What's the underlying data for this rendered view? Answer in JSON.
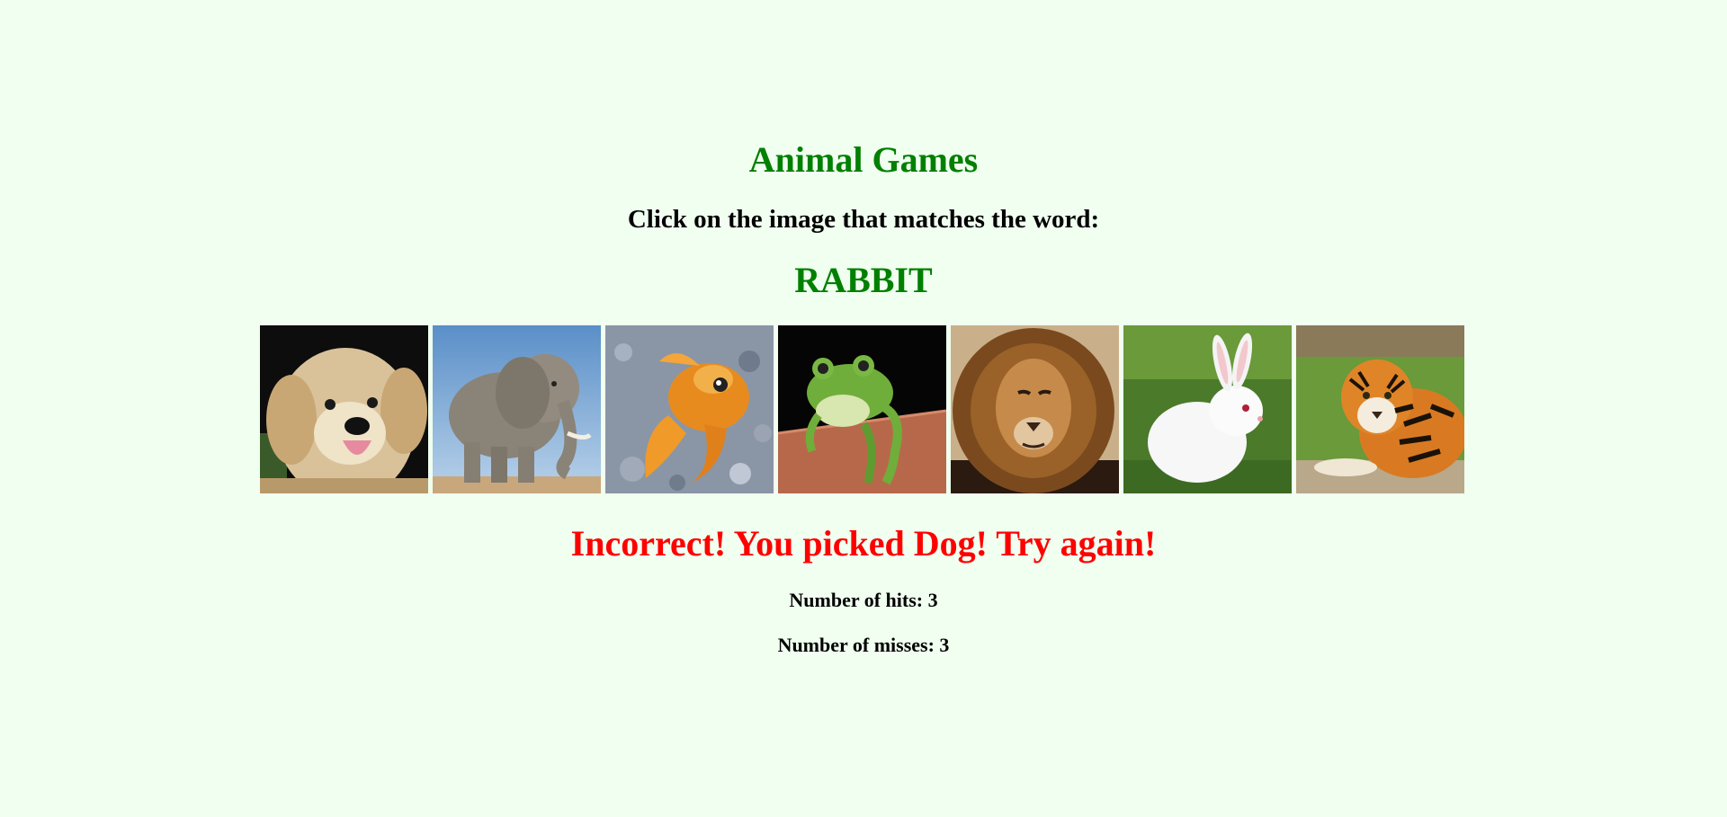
{
  "game": {
    "title": "Animal Games",
    "instruction": "Click on the image that matches the word:",
    "target_word": "RABBIT",
    "feedback": "Incorrect! You picked Dog! Try again!",
    "hits_label": "Number of hits: 3",
    "misses_label": "Number of misses: 3",
    "hits": 3,
    "misses": 3
  },
  "animals": [
    {
      "name": "Dog",
      "icon": "dog-image"
    },
    {
      "name": "Elephant",
      "icon": "elephant-image"
    },
    {
      "name": "Goldfish",
      "icon": "goldfish-image"
    },
    {
      "name": "Frog",
      "icon": "frog-image"
    },
    {
      "name": "Lion",
      "icon": "lion-image"
    },
    {
      "name": "Rabbit",
      "icon": "rabbit-image"
    },
    {
      "name": "Tiger",
      "icon": "tiger-image"
    }
  ],
  "colors": {
    "background": "#f0fff0",
    "title": "#008000",
    "feedback_error": "#ff0000"
  }
}
